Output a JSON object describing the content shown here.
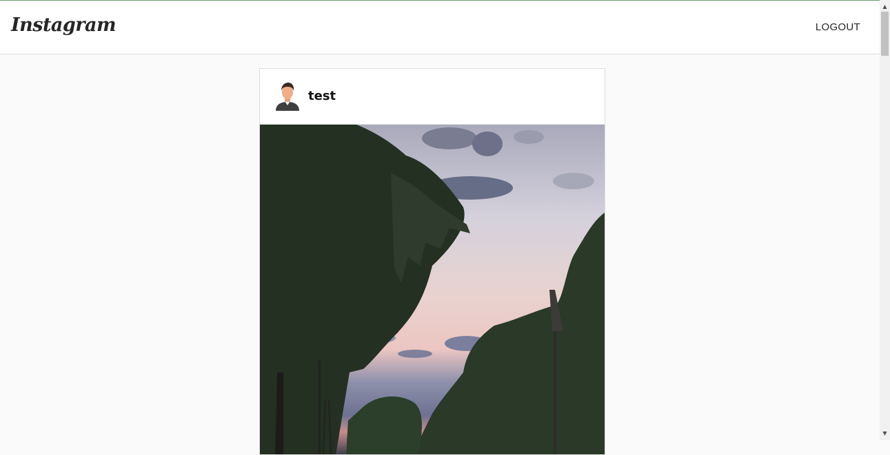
{
  "navbar": {
    "logo_text": "Instagram",
    "logout_label": "LOGOUT"
  },
  "post": {
    "username": "test",
    "avatar_icon": "user-avatar-icon"
  },
  "colors": {
    "navbar_bg": "#ffffff",
    "page_bg": "#fafafa",
    "border": "#dbdbdb"
  }
}
